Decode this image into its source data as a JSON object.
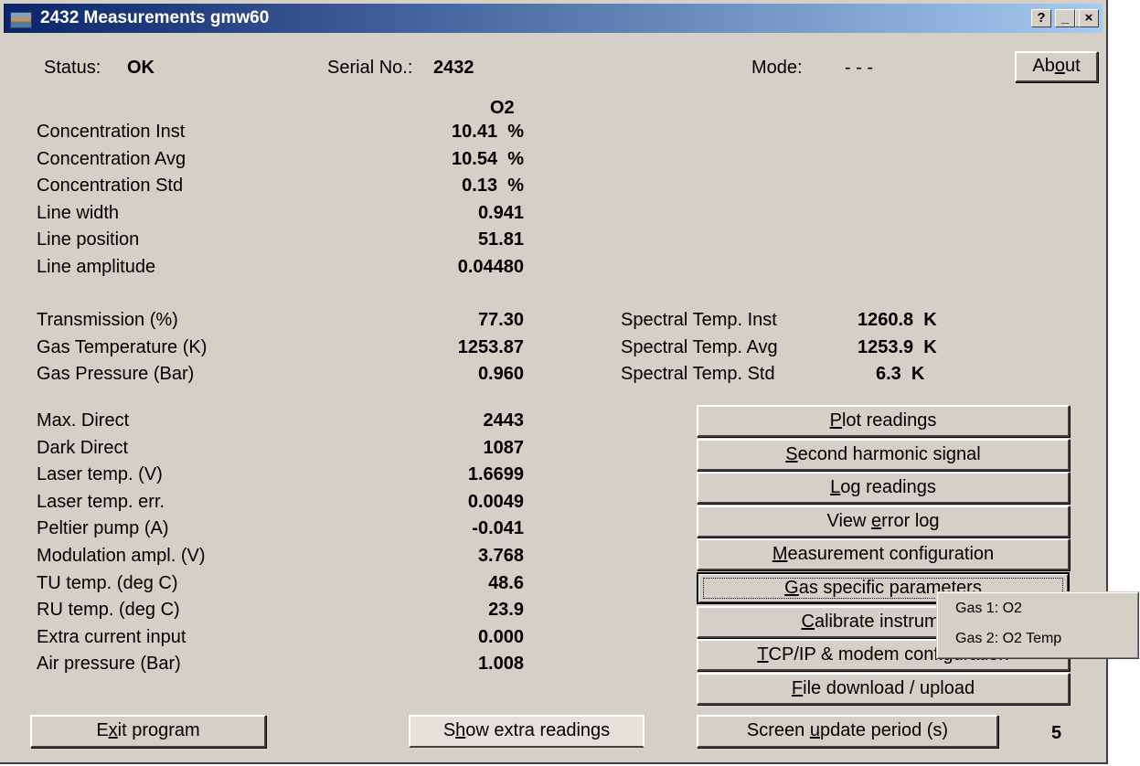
{
  "window": {
    "title": "2432 Measurements  gmw60",
    "buttons": [
      "?",
      "_",
      "□",
      "×"
    ]
  },
  "header": {
    "status_label": "Status:",
    "status_value": "OK",
    "serial_label": "Serial No.:",
    "serial_value": "2432",
    "mode_label": "Mode:",
    "mode_value": "- - -",
    "about_pre": "Ab",
    "about_key": "o",
    "about_post": "ut"
  },
  "gas_header": "O2",
  "readings_group1": [
    {
      "label": "Concentration Inst",
      "value": "10.41  %"
    },
    {
      "label": "Concentration Avg",
      "value": "10.54  %"
    },
    {
      "label": "Concentration Std",
      "value": "0.13  %"
    },
    {
      "label": "Line width",
      "value": "0.941"
    },
    {
      "label": "Line position",
      "value": "51.81"
    },
    {
      "label": "Line amplitude",
      "value": "0.04480"
    }
  ],
  "readings_group2": [
    {
      "label": "Transmission (%)",
      "value": "77.30"
    },
    {
      "label": "Gas Temperature (K)",
      "value": "1253.87"
    },
    {
      "label": "Gas Pressure (Bar)",
      "value": "0.960"
    }
  ],
  "spectral": [
    {
      "label": "Spectral Temp. Inst",
      "value": "1260.8  K"
    },
    {
      "label": "Spectral Temp. Avg",
      "value": "1253.9  K"
    },
    {
      "label": "Spectral Temp. Std",
      "value": "6.3  K"
    }
  ],
  "readings_group3": [
    {
      "label": "Max. Direct",
      "value": "2443"
    },
    {
      "label": "Dark Direct",
      "value": "1087"
    },
    {
      "label": "Laser temp. (V)",
      "value": "1.6699"
    },
    {
      "label": "Laser temp. err.",
      "value": "0.0049"
    },
    {
      "label": "Peltier pump (A)",
      "value": "-0.041"
    },
    {
      "label": "Modulation ampl. (V)",
      "value": "3.768"
    },
    {
      "label": "TU temp. (deg C)",
      "value": "48.6"
    },
    {
      "label": "RU temp. (deg C)",
      "value": "23.9"
    },
    {
      "label": "Extra current input",
      "value": "0.000"
    },
    {
      "label": "Air pressure (Bar)",
      "value": "1.008"
    }
  ],
  "side_buttons": [
    {
      "pre": "",
      "key": "P",
      "post": "lot readings"
    },
    {
      "pre": "",
      "key": "S",
      "post": "econd harmonic signal"
    },
    {
      "pre": "",
      "key": "L",
      "post": "og readings"
    },
    {
      "pre": "View ",
      "key": "e",
      "post": "rror log"
    },
    {
      "pre": "",
      "key": "M",
      "post": "easurement configuration"
    },
    {
      "pre": "",
      "key": "G",
      "post": "as specific parameters"
    },
    {
      "pre": "",
      "key": "C",
      "post": "alibrate instrument"
    },
    {
      "pre": "",
      "key": "T",
      "post": "CP/IP & modem configuration"
    },
    {
      "pre": "",
      "key": "F",
      "post": "ile download / upload"
    }
  ],
  "bottom": {
    "exit": {
      "pre": "E",
      "key": "x",
      "post": "it program"
    },
    "extra": {
      "pre": "S",
      "key": "h",
      "post": "ow extra readings"
    },
    "update": {
      "pre": "Screen ",
      "key": "u",
      "post": "pdate period (s)"
    },
    "update_value": "5"
  },
  "context_menu": [
    "Gas 1: O2",
    "Gas 2: O2 Temp"
  ]
}
